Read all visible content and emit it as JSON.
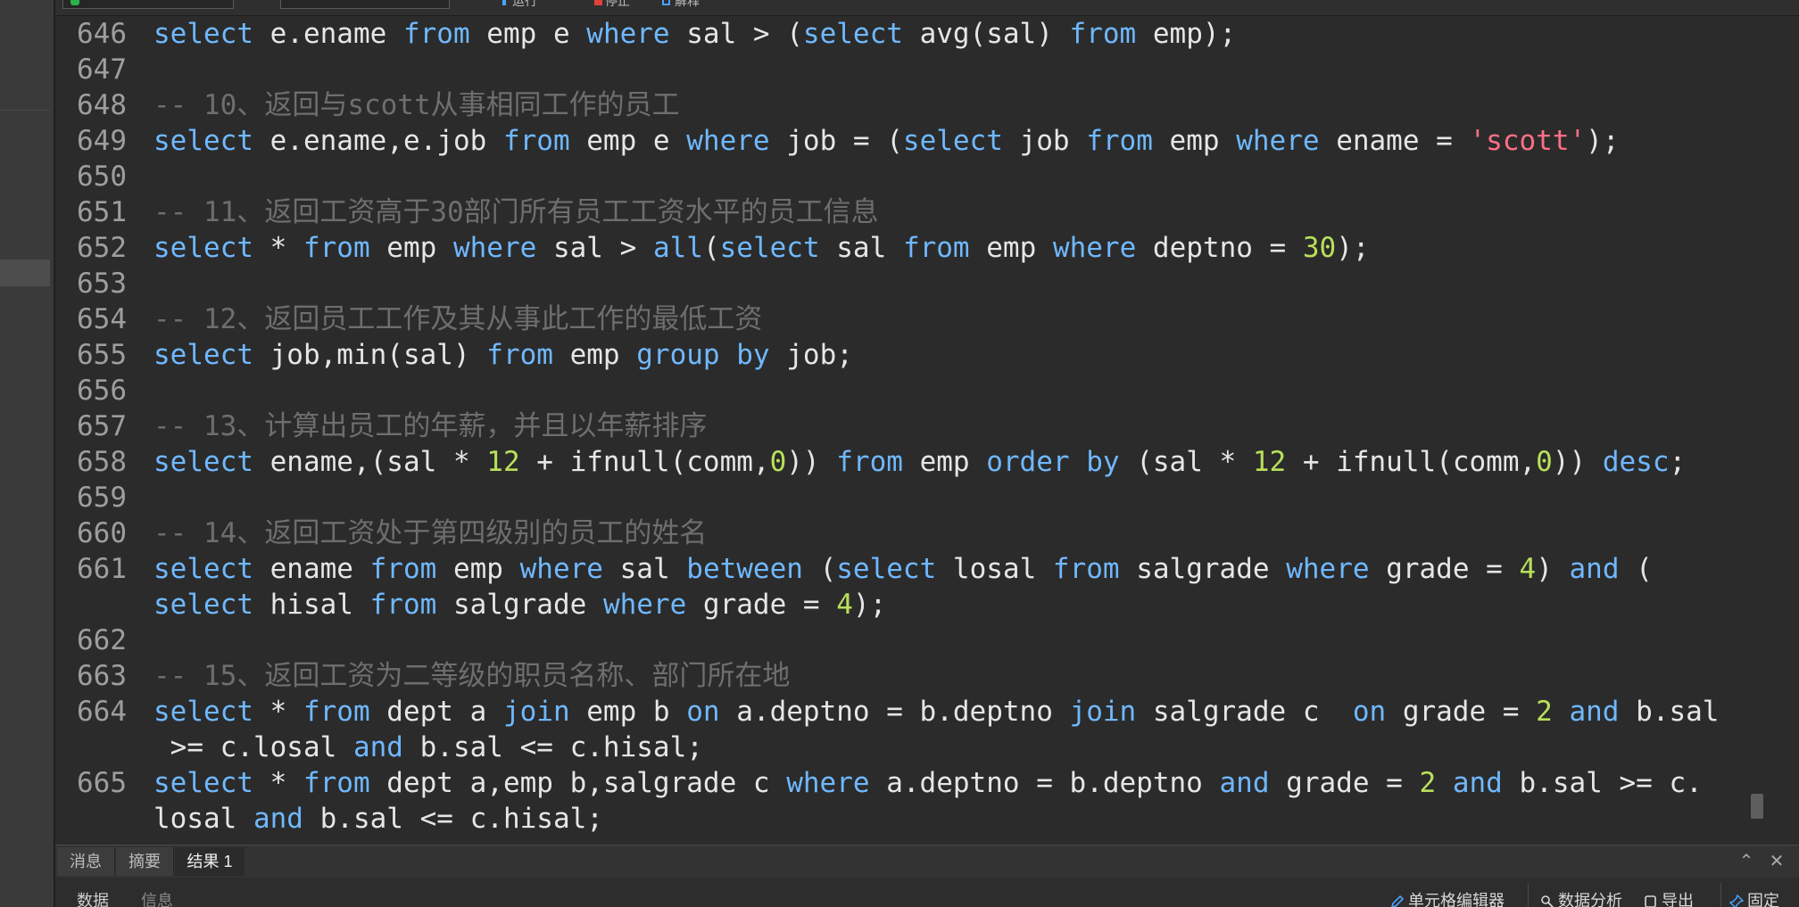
{
  "toolbar": {
    "run_label": "运行",
    "stop_label": "停止",
    "explain_label": "解释"
  },
  "editor": {
    "lines": [
      {
        "n": "646",
        "tokens": [
          [
            "kw",
            "select"
          ],
          [
            "tx",
            " e.ename "
          ],
          [
            "kw",
            "from"
          ],
          [
            "tx",
            " emp e "
          ],
          [
            "kw",
            "where"
          ],
          [
            "tx",
            " sal > ("
          ],
          [
            "kw",
            "select"
          ],
          [
            "tx",
            " avg(sal) "
          ],
          [
            "kw",
            "from"
          ],
          [
            "tx",
            " emp);"
          ]
        ]
      },
      {
        "n": "647",
        "tokens": []
      },
      {
        "n": "648",
        "tokens": [
          [
            "cm",
            "-- 10、返回与scott从事相同工作的员工"
          ]
        ]
      },
      {
        "n": "649",
        "tokens": [
          [
            "kw",
            "select"
          ],
          [
            "tx",
            " e.ename,e.job "
          ],
          [
            "kw",
            "from"
          ],
          [
            "tx",
            " emp e "
          ],
          [
            "kw",
            "where"
          ],
          [
            "tx",
            " job = ("
          ],
          [
            "kw",
            "select"
          ],
          [
            "tx",
            " job "
          ],
          [
            "kw",
            "from"
          ],
          [
            "tx",
            " emp "
          ],
          [
            "kw",
            "where"
          ],
          [
            "tx",
            " ename = "
          ],
          [
            "str",
            "'scott'"
          ],
          [
            "tx",
            ");"
          ]
        ]
      },
      {
        "n": "650",
        "tokens": []
      },
      {
        "n": "651",
        "tokens": [
          [
            "cm",
            "-- 11、返回工资高于30部门所有员工工资水平的员工信息"
          ]
        ]
      },
      {
        "n": "652",
        "tokens": [
          [
            "kw",
            "select"
          ],
          [
            "tx",
            " * "
          ],
          [
            "kw",
            "from"
          ],
          [
            "tx",
            " emp "
          ],
          [
            "kw",
            "where"
          ],
          [
            "tx",
            " sal > "
          ],
          [
            "kw",
            "all"
          ],
          [
            "tx",
            "("
          ],
          [
            "kw",
            "select"
          ],
          [
            "tx",
            " sal "
          ],
          [
            "kw",
            "from"
          ],
          [
            "tx",
            " emp "
          ],
          [
            "kw",
            "where"
          ],
          [
            "tx",
            " deptno = "
          ],
          [
            "num",
            "30"
          ],
          [
            "tx",
            ");"
          ]
        ]
      },
      {
        "n": "653",
        "tokens": []
      },
      {
        "n": "654",
        "tokens": [
          [
            "cm",
            "-- 12、返回员工工作及其从事此工作的最低工资"
          ]
        ]
      },
      {
        "n": "655",
        "tokens": [
          [
            "kw",
            "select"
          ],
          [
            "tx",
            " job,min(sal) "
          ],
          [
            "kw",
            "from"
          ],
          [
            "tx",
            " emp "
          ],
          [
            "kw",
            "group"
          ],
          [
            "tx",
            " "
          ],
          [
            "kw",
            "by"
          ],
          [
            "tx",
            " job;"
          ]
        ]
      },
      {
        "n": "656",
        "tokens": []
      },
      {
        "n": "657",
        "tokens": [
          [
            "cm",
            "-- 13、计算出员工的年薪，并且以年薪排序"
          ]
        ]
      },
      {
        "n": "658",
        "tokens": [
          [
            "kw",
            "select"
          ],
          [
            "tx",
            " ename,(sal * "
          ],
          [
            "num",
            "12"
          ],
          [
            "tx",
            " + ifnull(comm,"
          ],
          [
            "num",
            "0"
          ],
          [
            "tx",
            "))"
          ],
          [
            "tx",
            " "
          ],
          [
            "kw",
            "from"
          ],
          [
            "tx",
            " emp "
          ],
          [
            "kw",
            "order"
          ],
          [
            "tx",
            " "
          ],
          [
            "kw",
            "by"
          ],
          [
            "tx",
            " (sal * "
          ],
          [
            "num",
            "12"
          ],
          [
            "tx",
            " + ifnull(comm,"
          ],
          [
            "num",
            "0"
          ],
          [
            "tx",
            ")) "
          ],
          [
            "kw",
            "desc"
          ],
          [
            "tx",
            ";"
          ]
        ]
      },
      {
        "n": "659",
        "tokens": []
      },
      {
        "n": "660",
        "tokens": [
          [
            "cm",
            "-- 14、返回工资处于第四级别的员工的姓名"
          ]
        ]
      },
      {
        "n": "661",
        "tokens": [
          [
            "kw",
            "select"
          ],
          [
            "tx",
            " ename "
          ],
          [
            "kw",
            "from"
          ],
          [
            "tx",
            " emp "
          ],
          [
            "kw",
            "where"
          ],
          [
            "tx",
            " sal "
          ],
          [
            "kw",
            "between"
          ],
          [
            "tx",
            " ("
          ],
          [
            "kw",
            "select"
          ],
          [
            "tx",
            " losal "
          ],
          [
            "kw",
            "from"
          ],
          [
            "tx",
            " salgrade "
          ],
          [
            "kw",
            "where"
          ],
          [
            "tx",
            " grade = "
          ],
          [
            "num",
            "4"
          ],
          [
            "tx",
            ") "
          ],
          [
            "kw",
            "and"
          ],
          [
            "tx",
            " ("
          ]
        ]
      },
      {
        "n": "",
        "tokens": [
          [
            "kw",
            "select"
          ],
          [
            "tx",
            " hisal "
          ],
          [
            "kw",
            "from"
          ],
          [
            "tx",
            " salgrade "
          ],
          [
            "kw",
            "where"
          ],
          [
            "tx",
            " grade = "
          ],
          [
            "num",
            "4"
          ],
          [
            "tx",
            ");"
          ]
        ]
      },
      {
        "n": "662",
        "tokens": []
      },
      {
        "n": "663",
        "tokens": [
          [
            "cm",
            "-- 15、返回工资为二等级的职员名称、部门所在地"
          ]
        ]
      },
      {
        "n": "664",
        "tokens": [
          [
            "kw",
            "select"
          ],
          [
            "tx",
            " * "
          ],
          [
            "kw",
            "from"
          ],
          [
            "tx",
            " dept a "
          ],
          [
            "kw",
            "join"
          ],
          [
            "tx",
            " emp b "
          ],
          [
            "kw",
            "on"
          ],
          [
            "tx",
            " a.deptno = b.deptno "
          ],
          [
            "kw",
            "join"
          ],
          [
            "tx",
            " salgrade c  "
          ],
          [
            "kw",
            "on"
          ],
          [
            "tx",
            " grade = "
          ],
          [
            "num",
            "2"
          ],
          [
            "tx",
            " "
          ],
          [
            "kw",
            "and"
          ],
          [
            "tx",
            " b.sal"
          ]
        ]
      },
      {
        "n": "",
        "tokens": [
          [
            "tx",
            " >= c.losal "
          ],
          [
            "kw",
            "and"
          ],
          [
            "tx",
            " b.sal <= c.hisal;"
          ]
        ]
      },
      {
        "n": "665",
        "tokens": [
          [
            "kw",
            "select"
          ],
          [
            "tx",
            " * "
          ],
          [
            "kw",
            "from"
          ],
          [
            "tx",
            " dept a,emp b,salgrade c "
          ],
          [
            "kw",
            "where"
          ],
          [
            "tx",
            " a.deptno = b.deptno "
          ],
          [
            "kw",
            "and"
          ],
          [
            "tx",
            " grade = "
          ],
          [
            "num",
            "2"
          ],
          [
            "tx",
            " "
          ],
          [
            "kw",
            "and"
          ],
          [
            "tx",
            " b.sal >= c."
          ]
        ]
      },
      {
        "n": "",
        "tokens": [
          [
            "tx",
            "losal "
          ],
          [
            "kw",
            "and"
          ],
          [
            "tx",
            " b.sal <= c.hisal;"
          ]
        ]
      }
    ]
  },
  "result_tabs": {
    "tabs": [
      "消息",
      "摘要",
      "结果 1"
    ],
    "active": "结果 1",
    "collapse_icon": "chevron-up-icon",
    "close_icon": "close-icon"
  },
  "bottom_bar": {
    "data_tab": "数据",
    "info_tab": "信息",
    "cell_editor_label": "单元格编辑器",
    "data_analysis_label": "数据分析",
    "export_label": "导出",
    "pin_label": "固定"
  },
  "colors": {
    "keyword": "#6fb8ff",
    "comment": "#6e6e6e",
    "string": "#ff6f86",
    "number": "#b8e05a",
    "text": "#e6e6e6",
    "background": "#2b2b2b"
  }
}
